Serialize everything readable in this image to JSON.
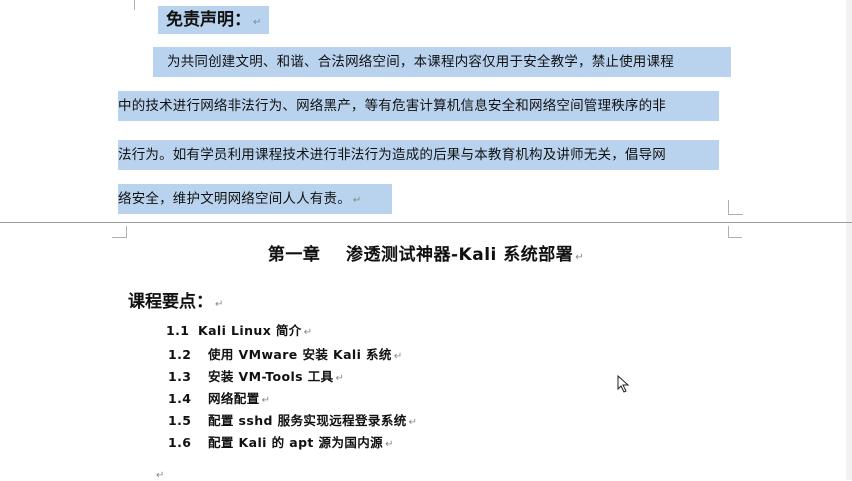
{
  "disclaimer": {
    "title": "免责声明：",
    "lines": [
      "为共同创建文明、和谐、合法网络空间，本课程内容仅用于安全教学，禁止使用课程",
      "中的技术进行网络非法行为、网络黑产，等有危害计算机信息安全和网络空间管理秩序的非",
      "法行为。如有学员利用课程技术进行非法行为造成的后果与本教育机构及讲师无关，倡导网",
      "络安全，维护文明网络空间人人有责。"
    ]
  },
  "chapter": {
    "title": "第一章    渗透测试神器-Kali 系统部署"
  },
  "section": {
    "heading": "课程要点："
  },
  "toc": [
    {
      "num": "1.1",
      "label": "Kali Linux 简介"
    },
    {
      "num": "1.2",
      "label": "使用 VMware 安装 Kali 系统"
    },
    {
      "num": "1.3",
      "label": "安装 VM-Tools 工具"
    },
    {
      "num": "1.4",
      "label": "网络配置"
    },
    {
      "num": "1.5",
      "label": "配置 sshd 服务实现远程登录系统"
    },
    {
      "num": "1.6",
      "label": "配置 Kali 的 apt 源为国内源"
    }
  ],
  "marks": {
    "paragraph": "↵"
  },
  "colors": {
    "selection": "#b9d3ef",
    "page_break": "#9a9a9a"
  }
}
